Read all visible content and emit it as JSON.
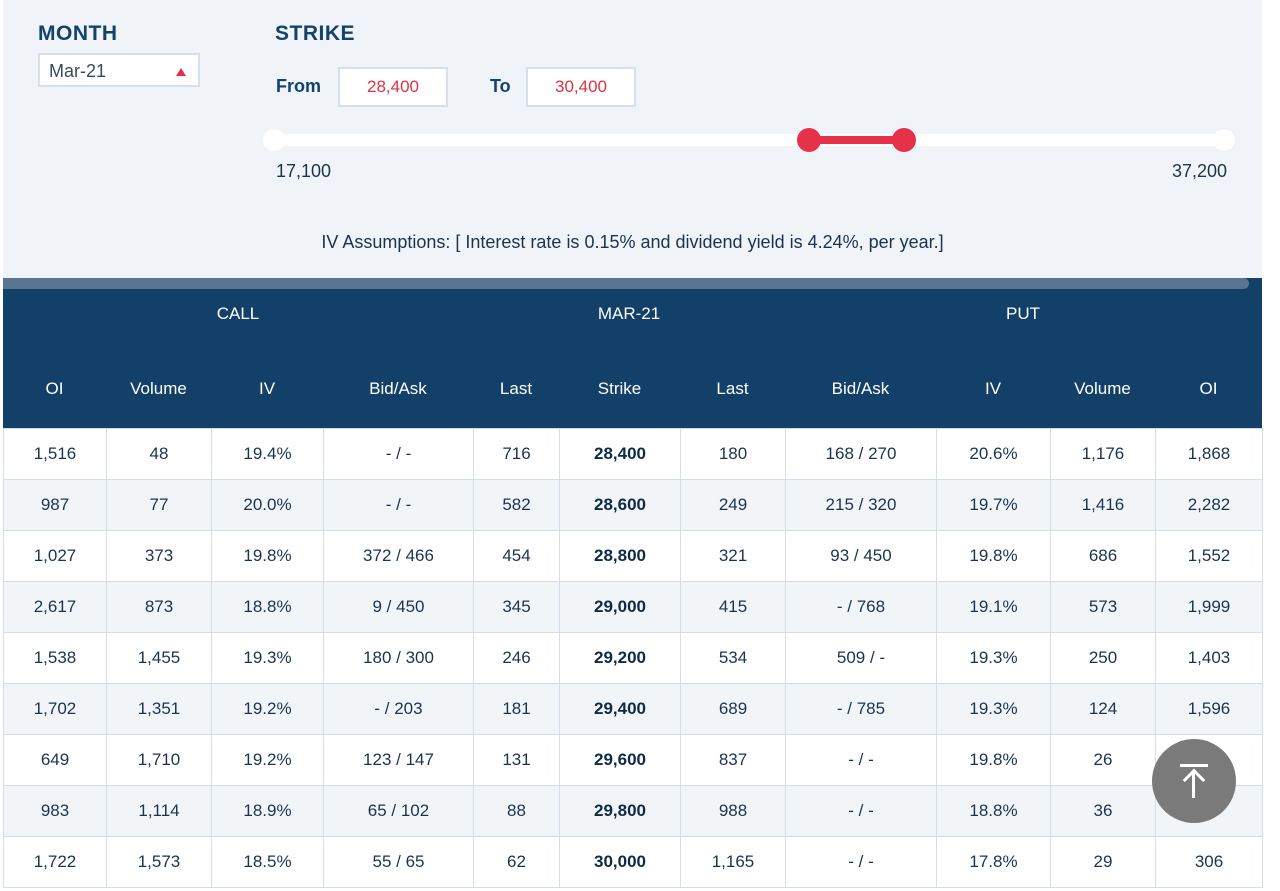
{
  "filters": {
    "month_title": "MONTH",
    "month_value": "Mar-21",
    "strike_title": "STRIKE",
    "from_label": "From",
    "from_value": "28,400",
    "to_label": "To",
    "to_value": "30,400",
    "range_min": "17,100",
    "range_max": "37,200",
    "iv_note": "IV Assumptions: [ Interest rate is 0.15% and dividend yield is 4.24%, per year.]",
    "accent_color": "#e6314a"
  },
  "table": {
    "groups": {
      "call": "CALL",
      "month": "MAR-21",
      "put": "PUT"
    },
    "columns": [
      "OI",
      "Volume",
      "IV",
      "Bid/Ask",
      "Last",
      "Strike",
      "Last",
      "Bid/Ask",
      "IV",
      "Volume",
      "OI"
    ],
    "rows": [
      [
        "1,516",
        "48",
        "19.4%",
        "- / -",
        "716",
        "28,400",
        "180",
        "168 / 270",
        "20.6%",
        "1,176",
        "1,868"
      ],
      [
        "987",
        "77",
        "20.0%",
        "- / -",
        "582",
        "28,600",
        "249",
        "215 / 320",
        "19.7%",
        "1,416",
        "2,282"
      ],
      [
        "1,027",
        "373",
        "19.8%",
        "372 / 466",
        "454",
        "28,800",
        "321",
        "93 / 450",
        "19.8%",
        "686",
        "1,552"
      ],
      [
        "2,617",
        "873",
        "18.8%",
        "9 / 450",
        "345",
        "29,000",
        "415",
        "- / 768",
        "19.1%",
        "573",
        "1,999"
      ],
      [
        "1,538",
        "1,455",
        "19.3%",
        "180 / 300",
        "246",
        "29,200",
        "534",
        "509 / -",
        "19.3%",
        "250",
        "1,403"
      ],
      [
        "1,702",
        "1,351",
        "19.2%",
        "- / 203",
        "181",
        "29,400",
        "689",
        "- / 785",
        "19.3%",
        "124",
        "1,596"
      ],
      [
        "649",
        "1,710",
        "19.2%",
        "123 / 147",
        "131",
        "29,600",
        "837",
        "- / -",
        "19.8%",
        "26",
        ""
      ],
      [
        "983",
        "1,114",
        "18.9%",
        "65 / 102",
        "88",
        "29,800",
        "988",
        "- / -",
        "18.8%",
        "36",
        ""
      ],
      [
        "1,722",
        "1,573",
        "18.5%",
        "55 / 65",
        "62",
        "30,000",
        "1,165",
        "- / -",
        "17.8%",
        "29",
        "306"
      ]
    ]
  },
  "fab": {
    "icon": "scroll-to-top-icon"
  }
}
